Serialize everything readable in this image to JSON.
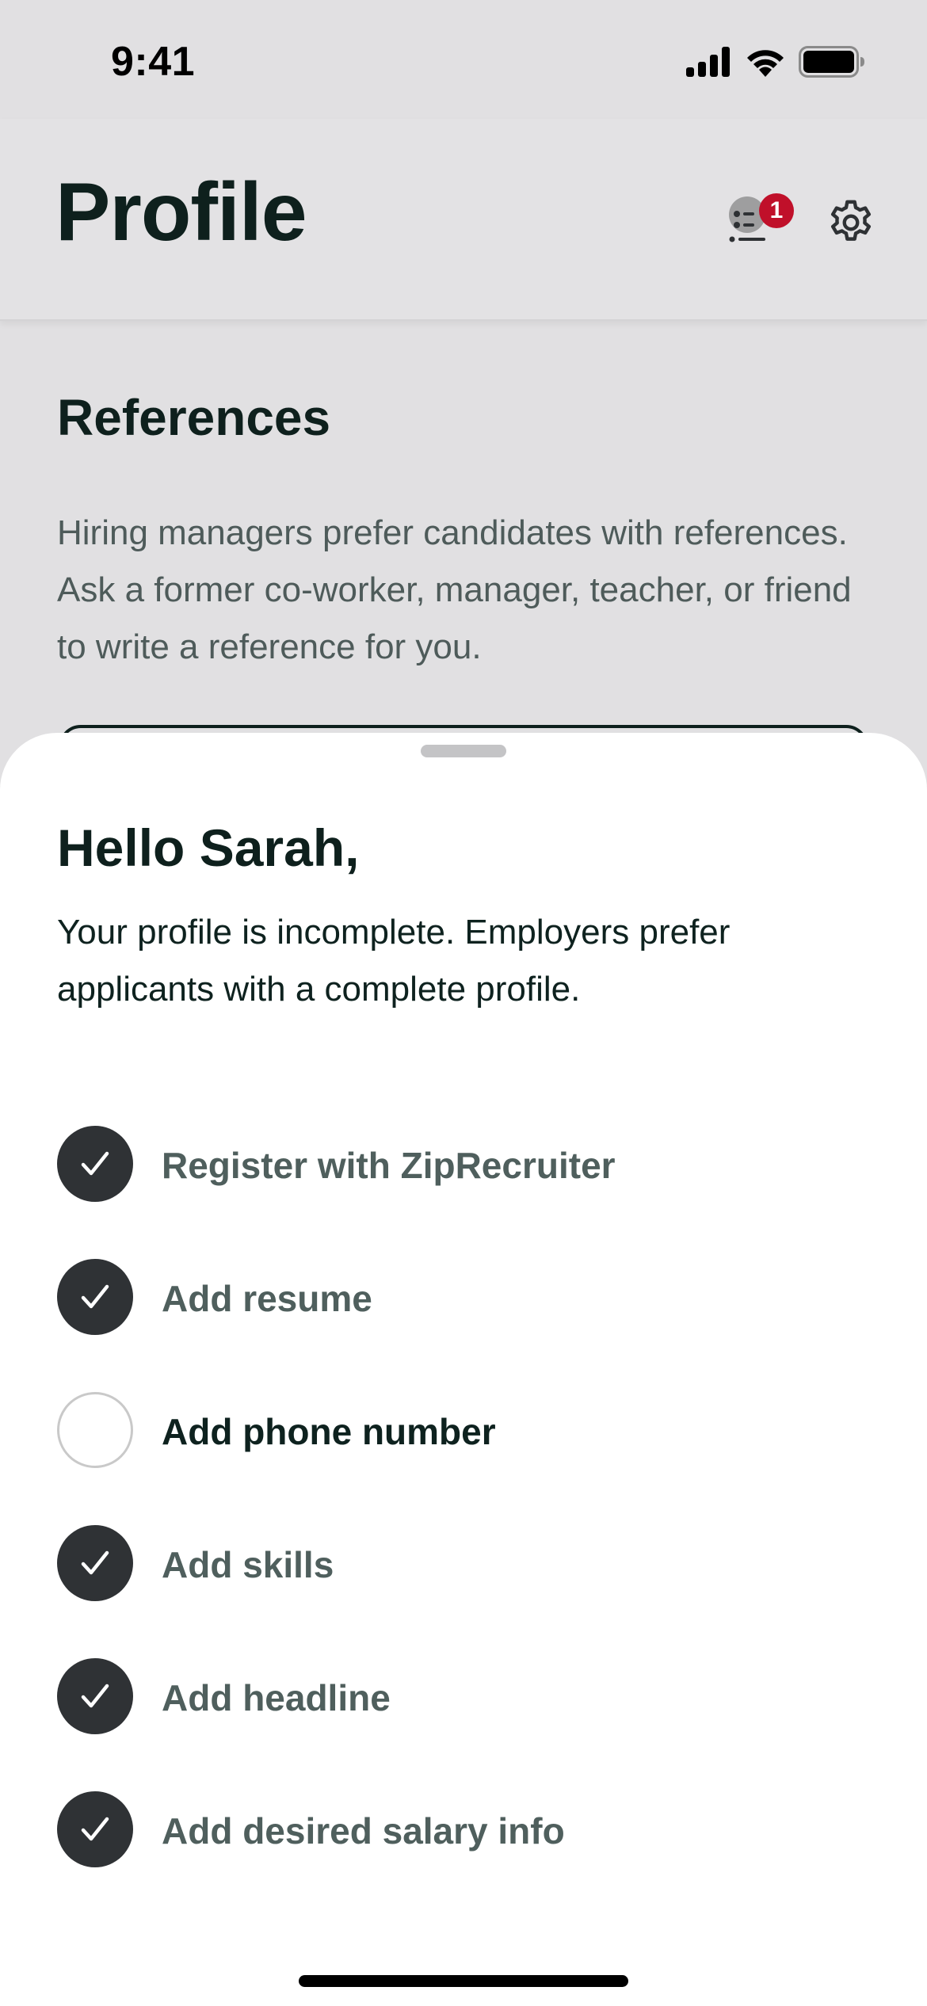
{
  "status_bar": {
    "time": "9:41",
    "icons": [
      "cellular-signal-icon",
      "wifi-icon",
      "battery-icon"
    ]
  },
  "header": {
    "title": "Profile",
    "checklist_icon": "checklist-icon",
    "notification_count": "1",
    "settings_icon": "gear-icon"
  },
  "references": {
    "title": "References",
    "body": "Hiring managers prefer candidates with references. Ask a former co-worker, manager, teacher, or friend to write a reference for you."
  },
  "sheet": {
    "title": "Hello Sarah,",
    "subtitle": "Your profile is incomplete. Employers prefer applicants with a complete profile.",
    "items": [
      {
        "label": "Register with ZipRecruiter",
        "completed": true
      },
      {
        "label": "Add resume",
        "completed": true
      },
      {
        "label": "Add phone number",
        "completed": false
      },
      {
        "label": "Add skills",
        "completed": true
      },
      {
        "label": "Add headline",
        "completed": true
      },
      {
        "label": "Add desired salary info",
        "completed": true
      }
    ]
  },
  "colors": {
    "primary_text": "#0e201d",
    "muted_text": "#4f5f5d",
    "badge": "#c0102a",
    "check_fill": "#2f3235",
    "overlay_bg": "#e1e0e2"
  }
}
